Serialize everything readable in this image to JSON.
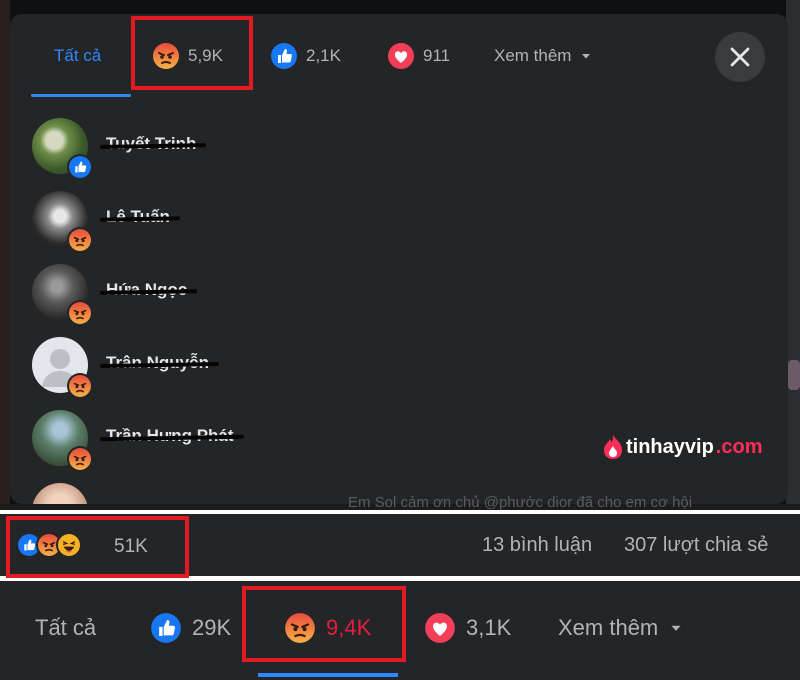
{
  "dialog": {
    "tabs": [
      {
        "label": "Tất cả",
        "icon": "none"
      },
      {
        "label": "5,9K",
        "icon": "angry-reaction-icon"
      },
      {
        "label": "2,1K",
        "icon": "like-reaction-icon"
      },
      {
        "label": "911",
        "icon": "love-reaction-icon"
      },
      {
        "label": "Xem thêm",
        "icon": "chevron-down-icon"
      }
    ],
    "people": [
      {
        "name": "Tuyết Trinh",
        "reaction": "like"
      },
      {
        "name": "Lê Tuấn",
        "reaction": "angry"
      },
      {
        "name": "Hứa Ngọc",
        "reaction": "angry"
      },
      {
        "name": "Trân Nguyễn",
        "reaction": "angry"
      },
      {
        "name": "Trần Hưng Phát",
        "reaction": "angry"
      }
    ],
    "watermark": {
      "brand": "tinhayvip",
      "suffix": ".com"
    }
  },
  "post": {
    "caption_fragment": "Em Sol cảm ơn chủ @phước dior đã cho em cơ hội"
  },
  "stats": {
    "reaction_count": "51K",
    "comments": "13 bình luận",
    "shares": "307 lượt chia sẻ"
  },
  "bottom_tabs": [
    {
      "label": "Tất cả"
    },
    {
      "label": "29K",
      "icon": "like-reaction-icon"
    },
    {
      "label": "9,4K",
      "icon": "angry-reaction-icon"
    },
    {
      "label": "3,1K",
      "icon": "love-reaction-icon"
    },
    {
      "label": "Xem thêm",
      "icon": "chevron-down-icon"
    }
  ],
  "colors": {
    "accent_blue": "#2d88ff",
    "angry_red": "#e41e3f",
    "highlight_red": "#e21b23",
    "panel_bg": "#242526"
  }
}
